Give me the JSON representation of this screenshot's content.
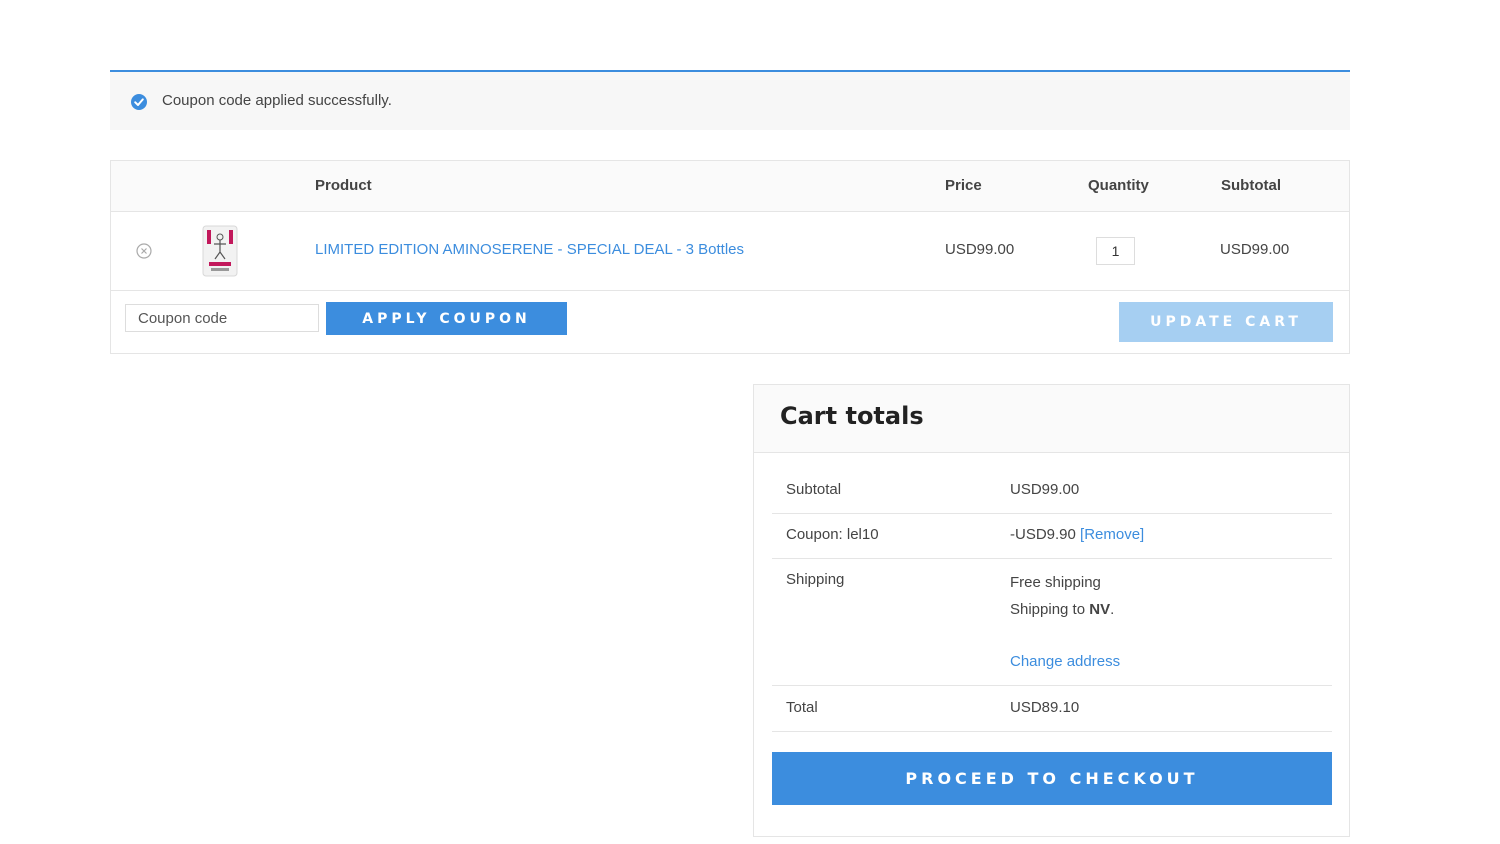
{
  "notice": {
    "message": "Coupon code applied successfully.",
    "color": "#3c8dde"
  },
  "cart": {
    "headers": {
      "product": "Product",
      "price": "Price",
      "quantity": "Quantity",
      "subtotal": "Subtotal"
    },
    "items": [
      {
        "name": "LIMITED EDITION AMINOSERENE - SPECIAL DEAL - 3 Bottles",
        "price": "USD99.00",
        "quantity": "1",
        "subtotal": "USD99.00"
      }
    ],
    "coupon_placeholder": "Coupon code",
    "apply_coupon_label": "Apply coupon",
    "update_cart_label": "Update cart"
  },
  "totals": {
    "title": "Cart totals",
    "subtotal_label": "Subtotal",
    "subtotal_value": "USD99.00",
    "coupon_label": "Coupon: lel10",
    "coupon_value": "-USD9.90",
    "coupon_remove": "[Remove]",
    "shipping_label": "Shipping",
    "shipping_method": "Free shipping",
    "shipping_to_prefix": "Shipping to",
    "shipping_to_state": "NV",
    "change_address": "Change address",
    "total_label": "Total",
    "total_value": "USD89.10",
    "checkout_label": "Proceed to checkout"
  },
  "icons": {
    "notice": "check-circle-icon",
    "remove": "remove-circle-icon",
    "thumbnail": "product-bottle-image"
  },
  "colors": {
    "accent": "#3c8dde",
    "accent_disabled": "#a6cff2",
    "border": "#e5e5e5"
  }
}
